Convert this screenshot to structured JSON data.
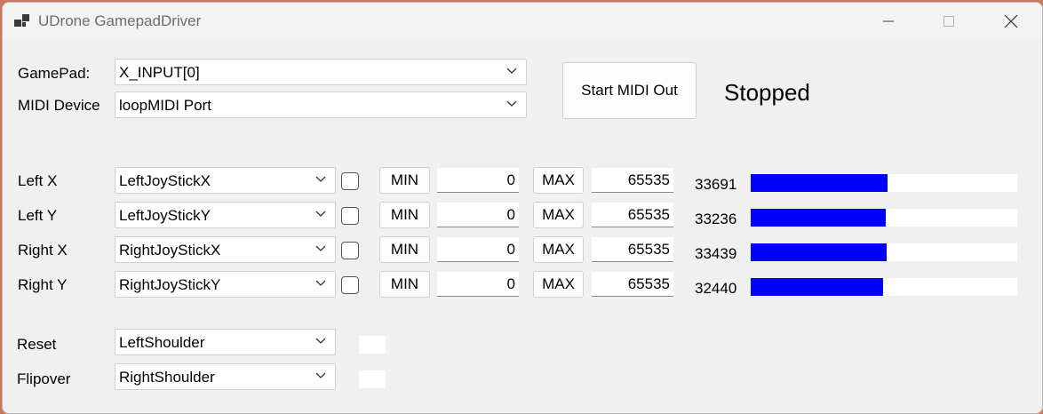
{
  "window": {
    "title": "UDrone GamepadDriver"
  },
  "colors": {
    "bar": "#0000ff"
  },
  "gamepad": {
    "label": "GamePad:",
    "value": "X_INPUT[0]"
  },
  "midi": {
    "label": "MIDI Device",
    "value": "loopMIDI Port"
  },
  "start_button": "Start MIDI Out",
  "status": "Stopped",
  "axes": [
    {
      "label": "Left X",
      "source": "LeftJoyStickX",
      "checked": false,
      "min_label": "MIN",
      "min": "0",
      "max_label": "MAX",
      "max": "65535",
      "value": "33691",
      "level": 0.514
    },
    {
      "label": "Left Y",
      "source": "LeftJoyStickY",
      "checked": false,
      "min_label": "MIN",
      "min": "0",
      "max_label": "MAX",
      "max": "65535",
      "value": "33236",
      "level": 0.507
    },
    {
      "label": "Right X",
      "source": "RightJoyStickX",
      "checked": false,
      "min_label": "MIN",
      "min": "0",
      "max_label": "MAX",
      "max": "65535",
      "value": "33439",
      "level": 0.51
    },
    {
      "label": "Right Y",
      "source": "RightJoyStickY",
      "checked": false,
      "min_label": "MIN",
      "min": "0",
      "max_label": "MAX",
      "max": "65535",
      "value": "32440",
      "level": 0.495
    }
  ],
  "buttons": [
    {
      "label": "Reset",
      "source": "LeftShoulder"
    },
    {
      "label": "Flipover",
      "source": "RightShoulder"
    }
  ]
}
